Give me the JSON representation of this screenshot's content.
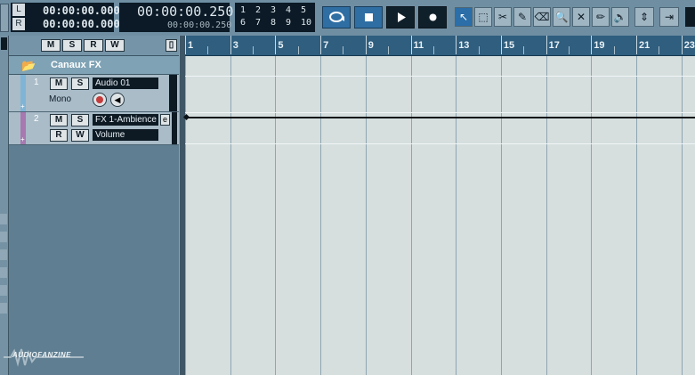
{
  "transport": {
    "locator_left": "00:00:00.000",
    "locator_right": "00:00:00.000",
    "locator_left_marker": "L",
    "locator_right_marker": "R",
    "position_main": "00:00:00.250",
    "position_sub": "00:00:00.250",
    "markers_top": [
      "1",
      "2",
      "3",
      "4",
      "5"
    ],
    "markers_bottom": [
      "6",
      "7",
      "8",
      "9",
      "10"
    ]
  },
  "tools": [
    {
      "name": "object-selection-icon",
      "glyph": "↖",
      "active": true
    },
    {
      "name": "range-selection-icon",
      "glyph": "⬚",
      "active": false
    },
    {
      "name": "split-icon",
      "glyph": "✂",
      "active": false
    },
    {
      "name": "glue-icon",
      "glyph": "✎",
      "active": false
    },
    {
      "name": "erase-icon",
      "glyph": "⌫",
      "active": false
    },
    {
      "name": "zoom-icon",
      "glyph": "🔍",
      "active": false
    },
    {
      "name": "mute-icon",
      "glyph": "✕",
      "active": false
    },
    {
      "name": "draw-icon",
      "glyph": "✏",
      "active": false
    },
    {
      "name": "speaker-icon",
      "glyph": "🔈",
      "active": false
    }
  ],
  "tracklist_header": {
    "buttons": [
      "M",
      "S",
      "R",
      "W"
    ]
  },
  "folder": {
    "name": "Canaux FX"
  },
  "tracks": [
    {
      "number": "1",
      "mute": "M",
      "solo": "S",
      "name": "Audio 01",
      "sub": "Mono",
      "color": "#7fb4d6"
    },
    {
      "number": "2",
      "mute": "M",
      "solo": "S",
      "name": "FX 1-Ambience",
      "read": "R",
      "write": "W",
      "automation": "Volume",
      "color": "#a779b0"
    }
  ],
  "ruler": {
    "labels": [
      "1",
      "3",
      "5",
      "7",
      "9",
      "11",
      "13",
      "15",
      "17",
      "19",
      "21",
      "23"
    ]
  },
  "watermark": "AUDIOFANZINE"
}
